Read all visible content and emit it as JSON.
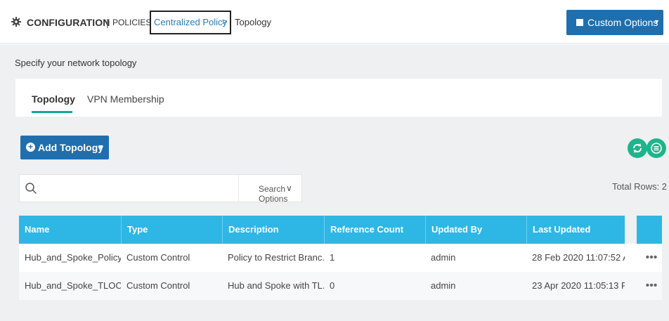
{
  "header": {
    "title": "CONFIGURATION",
    "separator": "|",
    "subtitle": "POLICIES",
    "breadcrumb": {
      "link": "Centralized Policy",
      "chevron": ">",
      "current": "Topology"
    },
    "custom_options": {
      "label": "Custom Options",
      "caret": "▼"
    }
  },
  "page_subtitle": "Specify your network topology",
  "tabs": [
    {
      "label": "Topology",
      "active": true
    },
    {
      "label": "VPN Membership",
      "active": false
    }
  ],
  "toolbar": {
    "add_button": {
      "icon": "plus",
      "label": "Add Topology",
      "caret": "▼"
    },
    "refresh_icon": "refresh-icon",
    "menu_icon": "list-menu-icon",
    "accent_color": "#1fb48b"
  },
  "search": {
    "placeholder": "",
    "value": "",
    "options_label": "Search Options",
    "options_chevron": "∨"
  },
  "total_rows": "Total Rows: 2",
  "table": {
    "header_color": "#2eb7e5",
    "columns": [
      "Name",
      "Type",
      "Description",
      "Reference Count",
      "Updated By",
      "Last Updated"
    ],
    "rows": [
      {
        "name": "Hub_and_Spoke_Policy",
        "type": "Custom Control",
        "description": "Policy to Restrict Branc...",
        "reference_count": "1",
        "updated_by": "admin",
        "last_updated": "28 Feb 2020 11:07:52 A...",
        "more": "•••"
      },
      {
        "name": "Hub_and_Spoke_TLOC_...",
        "type": "Custom Control",
        "description": "Hub and Spoke with TL...",
        "reference_count": "0",
        "updated_by": "admin",
        "last_updated": "23 Apr 2020 11:05:13 P...",
        "more": "•••"
      }
    ]
  }
}
